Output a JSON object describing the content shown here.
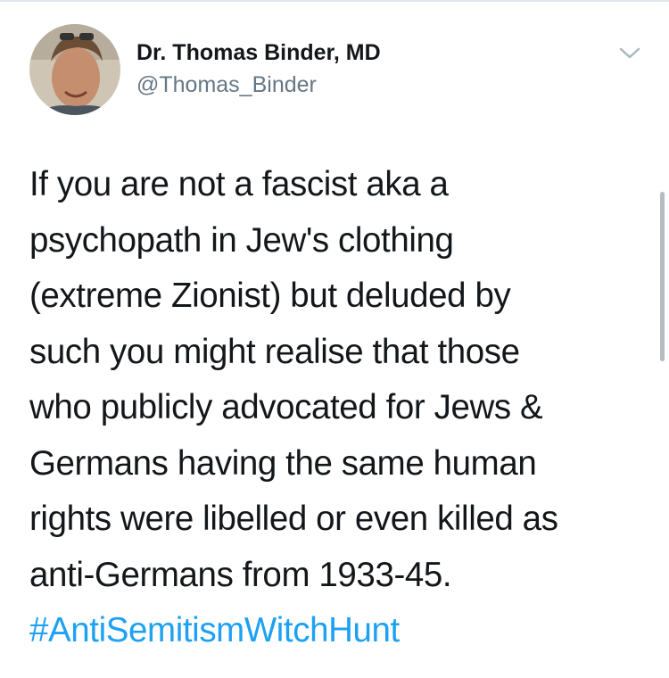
{
  "author": {
    "display_name": "Dr. Thomas Binder, MD",
    "handle": "@Thomas_Binder"
  },
  "tweet": {
    "lines": [
      "If you are not a fascist aka a",
      "psychopath in Jew's clothing",
      "(extreme Zionist) but deluded by",
      "such you might realise that those",
      "who publicly advocated for Jews &",
      "Germans having the same human",
      "rights were libelled or even killed as",
      "anti-Germans from 1933-45."
    ],
    "hashtag": "#AntiSemitismWitchHunt"
  },
  "icons": {
    "more": "chevron-down-icon"
  },
  "colors": {
    "text": "#14171a",
    "secondary": "#657786",
    "link": "#1da1f2"
  }
}
